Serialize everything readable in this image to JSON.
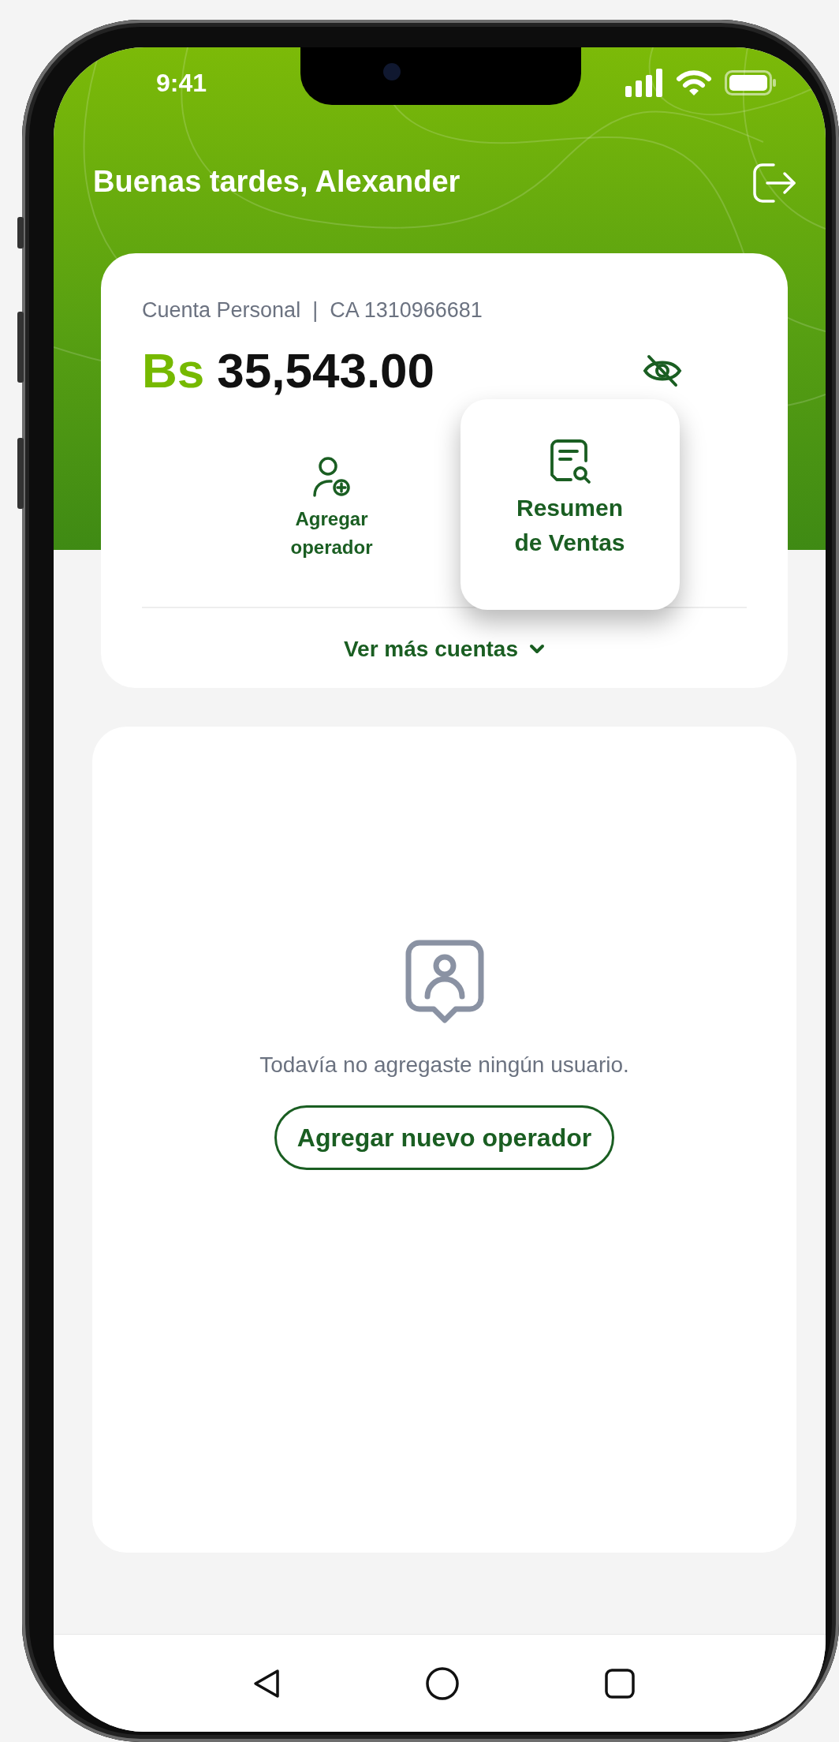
{
  "status_bar": {
    "time": "9:41"
  },
  "header": {
    "greeting": "Buenas tardes, Alexander"
  },
  "account": {
    "name": "Cuenta Personal",
    "separator": "|",
    "number": "CA 1310966681",
    "currency": "Bs",
    "balance": "35,543.00"
  },
  "actions": [
    {
      "kind": "add-operator",
      "label": "Agregar operador",
      "highlighted": false
    },
    {
      "kind": "sales-summary",
      "label": "Resumen de Ventas",
      "highlighted": true
    }
  ],
  "more_accounts": "Ver más cuentas",
  "empty_state": {
    "message": "Todavía no agregaste ningún usuario.",
    "button": "Agregar nuevo operador"
  }
}
